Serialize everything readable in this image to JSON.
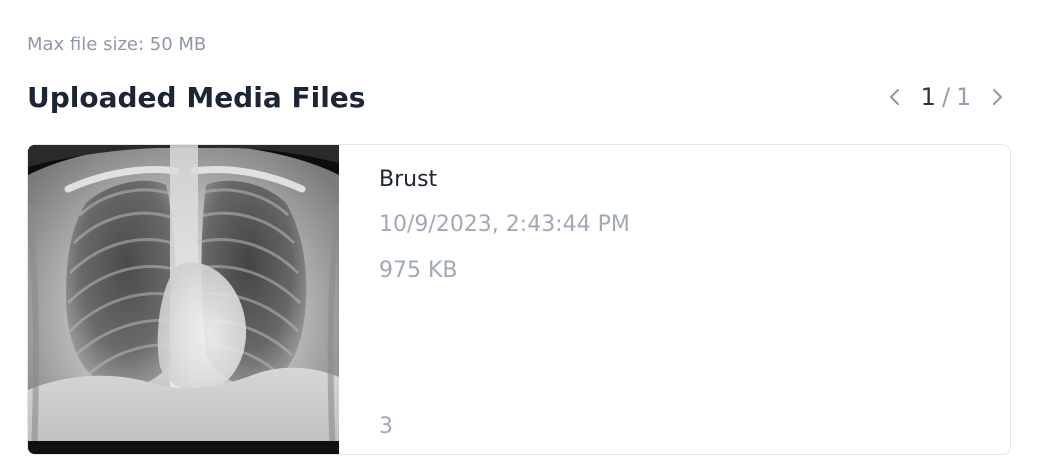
{
  "upload": {
    "max_file_size": "Max file size: 50 MB"
  },
  "section": {
    "title": "Uploaded Media Files"
  },
  "pagination": {
    "current": "1",
    "separator": "/",
    "total": "1",
    "prev_icon": "chevron-left-icon",
    "next_icon": "chevron-right-icon"
  },
  "files": [
    {
      "name": "Brust",
      "uploaded_at": "10/9/2023, 2:43:44 PM",
      "size": "975 KB",
      "count": "3",
      "thumbnail": "chest x-ray image"
    }
  ],
  "colors": {
    "title": "#1b2535",
    "muted": "#a0a9b6",
    "border": "#e3e6ea"
  }
}
